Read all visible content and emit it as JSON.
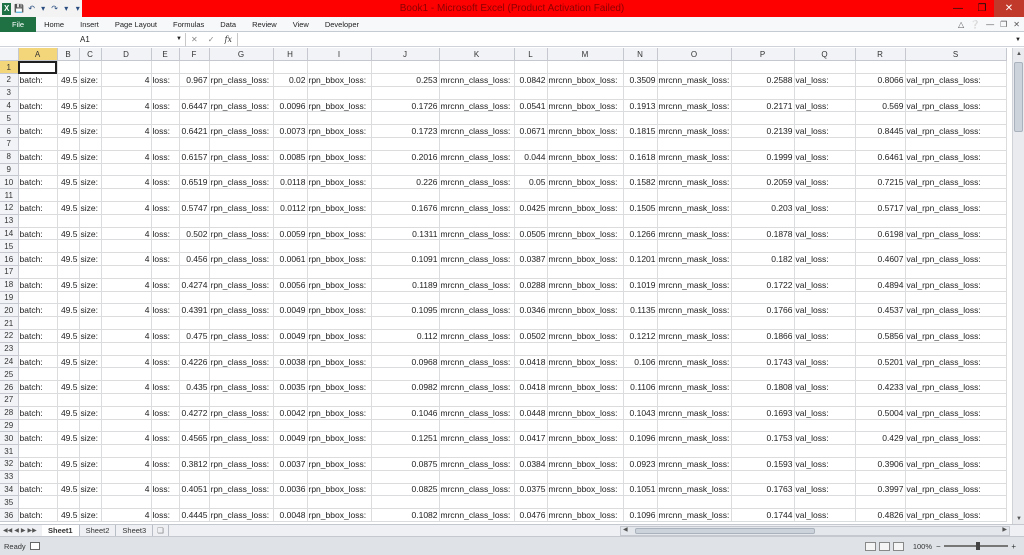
{
  "window": {
    "title": "Book1 - Microsoft Excel (Product Activation Failed)",
    "title_bg": "#ff0000"
  },
  "ribbon": {
    "tabs": [
      "File",
      "Home",
      "Insert",
      "Page Layout",
      "Formulas",
      "Data",
      "Review",
      "View",
      "Developer"
    ]
  },
  "formula_bar": {
    "name_box": "A1",
    "formula": ""
  },
  "grid": {
    "columns": [
      "A",
      "B",
      "C",
      "D",
      "E",
      "F",
      "G",
      "H",
      "I",
      "J",
      "K",
      "L",
      "M",
      "N",
      "O",
      "P",
      "Q",
      "R",
      "S"
    ],
    "labels": {
      "A": "batch:",
      "C": "size:",
      "E": "loss:",
      "G": "rpn_class_loss:",
      "I": "rpn_bbox_loss:",
      "K": "mrcnn_class_loss:",
      "M": "mrcnn_bbox_loss:",
      "O": "mrcnn_mask_loss:",
      "Q": "val_loss:",
      "S": "val_rpn_class_loss:"
    },
    "batch_value": "49.5",
    "size_value": "4",
    "rows": [
      {
        "row": 2,
        "loss": "0.967",
        "rpn_class": "0.02",
        "rpn_bbox": "0.253",
        "mrcnn_class": "0.0842",
        "mrcnn_bbox": "0.3509",
        "mrcnn_mask": "0.2588",
        "val_loss": "0.8066"
      },
      {
        "row": 4,
        "loss": "0.6447",
        "rpn_class": "0.0096",
        "rpn_bbox": "0.1726",
        "mrcnn_class": "0.0541",
        "mrcnn_bbox": "0.1913",
        "mrcnn_mask": "0.2171",
        "val_loss": "0.569"
      },
      {
        "row": 6,
        "loss": "0.6421",
        "rpn_class": "0.0073",
        "rpn_bbox": "0.1723",
        "mrcnn_class": "0.0671",
        "mrcnn_bbox": "0.1815",
        "mrcnn_mask": "0.2139",
        "val_loss": "0.8445"
      },
      {
        "row": 8,
        "loss": "0.6157",
        "rpn_class": "0.0085",
        "rpn_bbox": "0.2016",
        "mrcnn_class": "0.044",
        "mrcnn_bbox": "0.1618",
        "mrcnn_mask": "0.1999",
        "val_loss": "0.6461"
      },
      {
        "row": 10,
        "loss": "0.6519",
        "rpn_class": "0.0118",
        "rpn_bbox": "0.226",
        "mrcnn_class": "0.05",
        "mrcnn_bbox": "0.1582",
        "mrcnn_mask": "0.2059",
        "val_loss": "0.7215"
      },
      {
        "row": 12,
        "loss": "0.5747",
        "rpn_class": "0.0112",
        "rpn_bbox": "0.1676",
        "mrcnn_class": "0.0425",
        "mrcnn_bbox": "0.1505",
        "mrcnn_mask": "0.203",
        "val_loss": "0.5717"
      },
      {
        "row": 14,
        "loss": "0.502",
        "rpn_class": "0.0059",
        "rpn_bbox": "0.1311",
        "mrcnn_class": "0.0505",
        "mrcnn_bbox": "0.1266",
        "mrcnn_mask": "0.1878",
        "val_loss": "0.6198"
      },
      {
        "row": 16,
        "loss": "0.456",
        "rpn_class": "0.0061",
        "rpn_bbox": "0.1091",
        "mrcnn_class": "0.0387",
        "mrcnn_bbox": "0.1201",
        "mrcnn_mask": "0.182",
        "val_loss": "0.4607"
      },
      {
        "row": 18,
        "loss": "0.4274",
        "rpn_class": "0.0056",
        "rpn_bbox": "0.1189",
        "mrcnn_class": "0.0288",
        "mrcnn_bbox": "0.1019",
        "mrcnn_mask": "0.1722",
        "val_loss": "0.4894"
      },
      {
        "row": 20,
        "loss": "0.4391",
        "rpn_class": "0.0049",
        "rpn_bbox": "0.1095",
        "mrcnn_class": "0.0346",
        "mrcnn_bbox": "0.1135",
        "mrcnn_mask": "0.1766",
        "val_loss": "0.4537"
      },
      {
        "row": 22,
        "loss": "0.475",
        "rpn_class": "0.0049",
        "rpn_bbox": "0.112",
        "mrcnn_class": "0.0502",
        "mrcnn_bbox": "0.1212",
        "mrcnn_mask": "0.1866",
        "val_loss": "0.5856"
      },
      {
        "row": 24,
        "loss": "0.4226",
        "rpn_class": "0.0038",
        "rpn_bbox": "0.0968",
        "mrcnn_class": "0.0418",
        "mrcnn_bbox": "0.106",
        "mrcnn_mask": "0.1743",
        "val_loss": "0.5201"
      },
      {
        "row": 26,
        "loss": "0.435",
        "rpn_class": "0.0035",
        "rpn_bbox": "0.0982",
        "mrcnn_class": "0.0418",
        "mrcnn_bbox": "0.1106",
        "mrcnn_mask": "0.1808",
        "val_loss": "0.4233"
      },
      {
        "row": 28,
        "loss": "0.4272",
        "rpn_class": "0.0042",
        "rpn_bbox": "0.1046",
        "mrcnn_class": "0.0448",
        "mrcnn_bbox": "0.1043",
        "mrcnn_mask": "0.1693",
        "val_loss": "0.5004"
      },
      {
        "row": 30,
        "loss": "0.4565",
        "rpn_class": "0.0049",
        "rpn_bbox": "0.1251",
        "mrcnn_class": "0.0417",
        "mrcnn_bbox": "0.1096",
        "mrcnn_mask": "0.1753",
        "val_loss": "0.429"
      },
      {
        "row": 32,
        "loss": "0.3812",
        "rpn_class": "0.0037",
        "rpn_bbox": "0.0875",
        "mrcnn_class": "0.0384",
        "mrcnn_bbox": "0.0923",
        "mrcnn_mask": "0.1593",
        "val_loss": "0.3906"
      },
      {
        "row": 34,
        "loss": "0.4051",
        "rpn_class": "0.0036",
        "rpn_bbox": "0.0825",
        "mrcnn_class": "0.0375",
        "mrcnn_bbox": "0.1051",
        "mrcnn_mask": "0.1763",
        "val_loss": "0.3997"
      },
      {
        "row": 36,
        "loss": "0.4445",
        "rpn_class": "0.0048",
        "rpn_bbox": "0.1082",
        "mrcnn_class": "0.0476",
        "mrcnn_bbox": "0.1096",
        "mrcnn_mask": "0.1744",
        "val_loss": "0.4826"
      }
    ]
  },
  "sheets": {
    "tabs": [
      "Sheet1",
      "Sheet2",
      "Sheet3"
    ],
    "active": "Sheet1"
  },
  "status": {
    "ready": "Ready",
    "zoom": "100%"
  },
  "icons": {
    "app": "excel-logo-icon",
    "save": "save-icon",
    "undo": "undo-icon",
    "redo": "redo-icon"
  }
}
